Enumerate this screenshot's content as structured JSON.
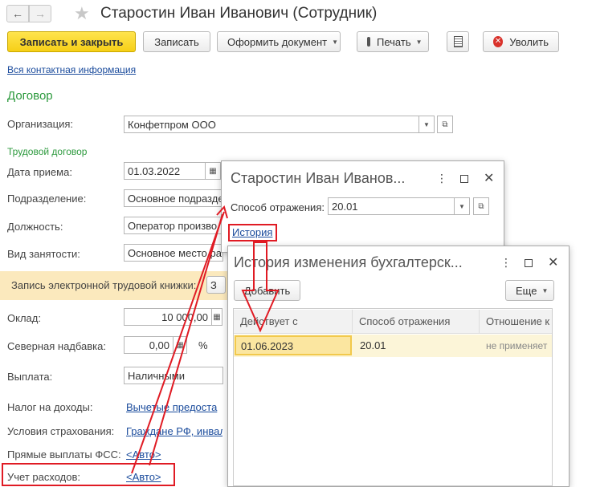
{
  "window": {
    "title": "Старостин Иван Иванович (Сотрудник)",
    "back_icon": "arrow-left-icon",
    "forward_icon": "arrow-right-icon",
    "favorite_icon": "star-icon"
  },
  "toolbar": {
    "save_close": "Записать и закрыть",
    "save": "Записать",
    "make_doc": "Оформить документ",
    "print": "Печать",
    "dismiss": "Уволить"
  },
  "contacts_link": "Вся контактная информация",
  "contract": {
    "heading": "Договор",
    "org_label": "Организация:",
    "org_value": "Конфетпром ООО",
    "labor_heading": "Трудовой договор",
    "hire_label": "Дата приема:",
    "hire_value": "01.03.2022",
    "dept_label": "Подразделение:",
    "dept_value": "Основное подразде",
    "position_label": "Должность:",
    "position_value": "Оператор произво",
    "employment_label": "Вид занятости:",
    "employment_value": "Основное место ра",
    "book_label": "Запись электронной трудовой книжки:",
    "book_btn": "З",
    "salary_label": "Оклад:",
    "salary_value": "10 000,00",
    "north_label": "Северная надбавка:",
    "north_value": "0,00",
    "north_unit": "%",
    "payment_label": "Выплата:",
    "payment_value": "Наличными",
    "tax_label": "Налог на доходы:",
    "tax_value": "Вычетые предоста",
    "insurance_label": "Условия страхования:",
    "insurance_value": "Граждане РФ, инвал",
    "fss_label": "Прямые выплаты ФСС:",
    "fss_value": "<Авто>",
    "expense_label": "Учет расходов:",
    "expense_value": "<Авто>"
  },
  "popup1": {
    "title": "Старостин Иван Иванов...",
    "method_label": "Способ отражения:",
    "method_value": "20.01",
    "history_link": "История"
  },
  "popup2": {
    "title": "История изменения бухгалтерск...",
    "add_btn": "Добавить",
    "more_btn": "Еще",
    "columns": [
      "Действует с",
      "Способ отражения",
      "Отношение к"
    ],
    "row": {
      "date": "01.06.2023",
      "method": "20.01",
      "relation": "не применяет"
    }
  },
  "colors": {
    "annotation": "#e01b24",
    "accent_green": "#2d9a3e",
    "primary_button": "#f6cf17"
  }
}
